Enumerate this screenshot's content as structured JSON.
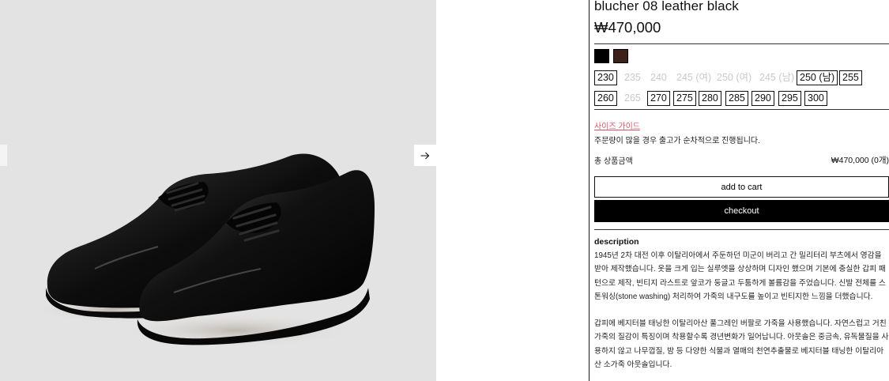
{
  "product": {
    "title": "blucher 08 leather black",
    "price": "₩470,000"
  },
  "colors": [
    {
      "name": "black",
      "hex": "#000000"
    },
    {
      "name": "brown",
      "hex": "#3e2118"
    }
  ],
  "sizes": [
    {
      "label": "230",
      "available": true
    },
    {
      "label": "235",
      "available": false
    },
    {
      "label": "240",
      "available": false
    },
    {
      "label": "245 (여)",
      "available": false
    },
    {
      "label": "250 (여)",
      "available": false
    },
    {
      "label": "245 (남)",
      "available": false
    },
    {
      "label": "250 (남)",
      "available": true
    },
    {
      "label": "255",
      "available": true
    },
    {
      "label": "260",
      "available": true
    },
    {
      "label": "265",
      "available": false
    },
    {
      "label": "270",
      "available": true
    },
    {
      "label": "275",
      "available": true
    },
    {
      "label": "280",
      "available": true
    },
    {
      "label": "285",
      "available": true
    },
    {
      "label": "290",
      "available": true
    },
    {
      "label": "295",
      "available": true
    },
    {
      "label": "300",
      "available": true
    }
  ],
  "size_guide": "사이즈 가이드",
  "notice": "주문량이 많을 경우 출고가 순차적으로 진행됩니다.",
  "total": {
    "label": "총 상품금액",
    "value": "₩470,000 (0개)"
  },
  "buttons": {
    "add_to_cart": "add to cart",
    "checkout": "checkout"
  },
  "description": {
    "heading": "description",
    "paragraph1": "1945년 2차 대전 이후 이탈리아에서 주둔하던 미군이 버리고 간 밀리터리 부츠에서 영감을 받아 제작했습니다. 옷을 크게 입는 실루엣을 상상하며 디자인 했으며 기본에 충실한 갑피 패턴으로 제작, 빈티지 라스트로 앞코가 둥글고 두툼하게 볼륨감을 주었습니다. 신발 전체를 스톤워싱(stone washing) 처리하여 가죽의 내구도를 높이고 빈티지한 느낌을 더했습니다.",
    "paragraph2": "갑피에 베지터블 태닝한 이탈리아산 풀그레인 버팔로 가죽을 사용했습니다. 자연스럽고 거친 가죽의 질감이 특징이며 착용할수록 경년변화가 일어납니다. 아웃솔은 중금속, 유독물질을 사용하지 않고 나무껍질, 밤 등 다양한 식물과 열매의 천연추출물로 베지터블 태닝한 이탈리아산 소가죽 아웃솔입니다."
  },
  "icons": {
    "next": "arrow-right-icon"
  }
}
